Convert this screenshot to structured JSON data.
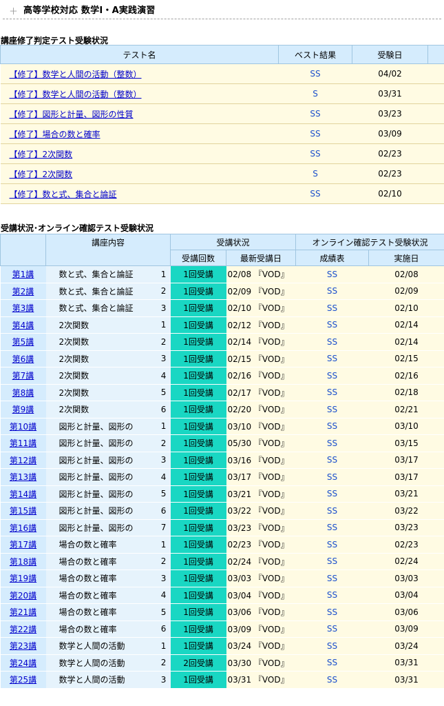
{
  "header": {
    "title": "高等学校対応 数学Ⅰ・A実践演習"
  },
  "exam_section": {
    "title": "講座修了判定テスト受験状況",
    "columns": [
      "テスト名",
      "ベスト結果",
      "受験日"
    ],
    "rows": [
      {
        "name": "【修了】数学と人間の活動（整数）",
        "result": "SS",
        "date": "04/02"
      },
      {
        "name": "【修了】数学と人間の活動（整数）",
        "result": "S",
        "date": "03/31"
      },
      {
        "name": "【修了】図形と計量、図形の性質",
        "result": "SS",
        "date": "03/23"
      },
      {
        "name": "【修了】場合の数と確率",
        "result": "SS",
        "date": "03/09"
      },
      {
        "name": "【修了】2次関数",
        "result": "SS",
        "date": "02/23"
      },
      {
        "name": "【修了】2次関数",
        "result": "S",
        "date": "02/23"
      },
      {
        "name": "【修了】数と式、集合と論証",
        "result": "SS",
        "date": "02/10"
      }
    ]
  },
  "lecture_section": {
    "title": "受講状況･オンライン確認テスト受験状況",
    "header": {
      "content": "講座内容",
      "status": "受講状況",
      "online": "オンライン確認テスト受験状況",
      "count": "受講回数",
      "latest": "最新受講日",
      "grade": "成績表",
      "date": "実施日"
    },
    "rows": [
      {
        "lecture": "第1講",
        "content": "数と式、集合と論証",
        "num": "1",
        "count": "1回受講",
        "latest": "02/08 『VOD』",
        "grade": "SS",
        "date": "02/08"
      },
      {
        "lecture": "第2講",
        "content": "数と式、集合と論証",
        "num": "2",
        "count": "1回受講",
        "latest": "02/09 『VOD』",
        "grade": "SS",
        "date": "02/09"
      },
      {
        "lecture": "第3講",
        "content": "数と式、集合と論証",
        "num": "3",
        "count": "1回受講",
        "latest": "02/10 『VOD』",
        "grade": "SS",
        "date": "02/10"
      },
      {
        "lecture": "第4講",
        "content": "2次関数",
        "num": "1",
        "count": "1回受講",
        "latest": "02/12 『VOD』",
        "grade": "SS",
        "date": "02/14"
      },
      {
        "lecture": "第5講",
        "content": "2次関数",
        "num": "2",
        "count": "1回受講",
        "latest": "02/14 『VOD』",
        "grade": "SS",
        "date": "02/14"
      },
      {
        "lecture": "第6講",
        "content": "2次関数",
        "num": "3",
        "count": "1回受講",
        "latest": "02/15 『VOD』",
        "grade": "SS",
        "date": "02/15"
      },
      {
        "lecture": "第7講",
        "content": "2次関数",
        "num": "4",
        "count": "1回受講",
        "latest": "02/16 『VOD』",
        "grade": "SS",
        "date": "02/16"
      },
      {
        "lecture": "第8講",
        "content": "2次関数",
        "num": "5",
        "count": "1回受講",
        "latest": "02/17 『VOD』",
        "grade": "SS",
        "date": "02/18"
      },
      {
        "lecture": "第9講",
        "content": "2次関数",
        "num": "6",
        "count": "1回受講",
        "latest": "02/20 『VOD』",
        "grade": "SS",
        "date": "02/21"
      },
      {
        "lecture": "第10講",
        "content": "図形と計量、図形の",
        "num": "1",
        "count": "1回受講",
        "latest": "03/10 『VOD』",
        "grade": "SS",
        "date": "03/10"
      },
      {
        "lecture": "第11講",
        "content": "図形と計量、図形の",
        "num": "2",
        "count": "1回受講",
        "latest": "05/30 『VOD』",
        "grade": "SS",
        "date": "03/15"
      },
      {
        "lecture": "第12講",
        "content": "図形と計量、図形の",
        "num": "3",
        "count": "1回受講",
        "latest": "03/16 『VOD』",
        "grade": "SS",
        "date": "03/17"
      },
      {
        "lecture": "第13講",
        "content": "図形と計量、図形の",
        "num": "4",
        "count": "1回受講",
        "latest": "03/17 『VOD』",
        "grade": "SS",
        "date": "03/17"
      },
      {
        "lecture": "第14講",
        "content": "図形と計量、図形の",
        "num": "5",
        "count": "1回受講",
        "latest": "03/21 『VOD』",
        "grade": "SS",
        "date": "03/21"
      },
      {
        "lecture": "第15講",
        "content": "図形と計量、図形の",
        "num": "6",
        "count": "1回受講",
        "latest": "03/22 『VOD』",
        "grade": "SS",
        "date": "03/22"
      },
      {
        "lecture": "第16講",
        "content": "図形と計量、図形の",
        "num": "7",
        "count": "1回受講",
        "latest": "03/23 『VOD』",
        "grade": "SS",
        "date": "03/23"
      },
      {
        "lecture": "第17講",
        "content": "場合の数と確率",
        "num": "1",
        "count": "1回受講",
        "latest": "02/23 『VOD』",
        "grade": "SS",
        "date": "02/23"
      },
      {
        "lecture": "第18講",
        "content": "場合の数と確率",
        "num": "2",
        "count": "1回受講",
        "latest": "02/24 『VOD』",
        "grade": "SS",
        "date": "02/24"
      },
      {
        "lecture": "第19講",
        "content": "場合の数と確率",
        "num": "3",
        "count": "1回受講",
        "latest": "03/03 『VOD』",
        "grade": "SS",
        "date": "03/03"
      },
      {
        "lecture": "第20講",
        "content": "場合の数と確率",
        "num": "4",
        "count": "1回受講",
        "latest": "03/04 『VOD』",
        "grade": "SS",
        "date": "03/04"
      },
      {
        "lecture": "第21講",
        "content": "場合の数と確率",
        "num": "5",
        "count": "1回受講",
        "latest": "03/06 『VOD』",
        "grade": "SS",
        "date": "03/06"
      },
      {
        "lecture": "第22講",
        "content": "場合の数と確率",
        "num": "6",
        "count": "1回受講",
        "latest": "03/09 『VOD』",
        "grade": "SS",
        "date": "03/09"
      },
      {
        "lecture": "第23講",
        "content": "数学と人間の活動",
        "num": "1",
        "count": "1回受講",
        "latest": "03/24 『VOD』",
        "grade": "SS",
        "date": "03/24"
      },
      {
        "lecture": "第24講",
        "content": "数学と人間の活動",
        "num": "2",
        "count": "2回受講",
        "latest": "03/30 『VOD』",
        "grade": "SS",
        "date": "03/31"
      },
      {
        "lecture": "第25講",
        "content": "数学と人間の活動",
        "num": "3",
        "count": "1回受講",
        "latest": "03/31 『VOD』",
        "grade": "SS",
        "date": "03/31"
      }
    ]
  }
}
